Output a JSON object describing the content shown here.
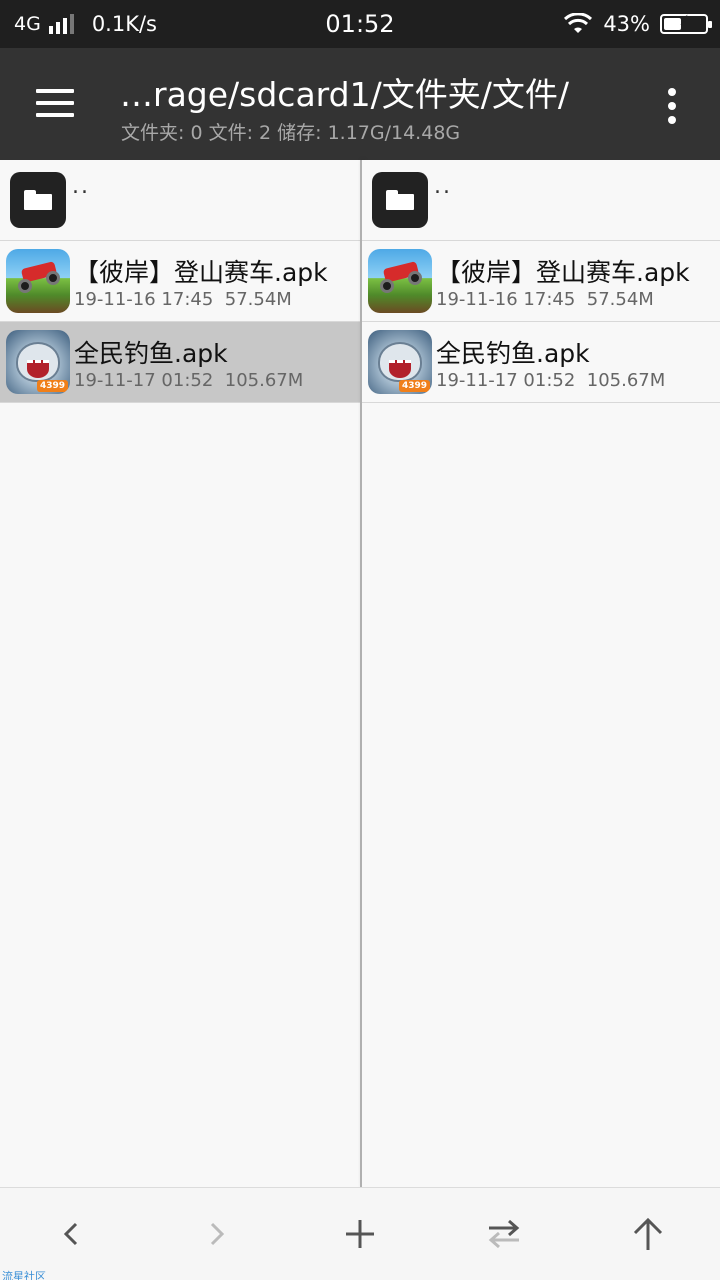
{
  "status_bar": {
    "network": "4G",
    "speed": "0.1K/s",
    "time": "01:52",
    "battery_percent": "43%",
    "battery_level": 0.43,
    "icons": [
      "signal-icon",
      "wifi-icon",
      "battery-charging-icon"
    ]
  },
  "toolbar": {
    "path": "…rage/sdcard1/文件夹/文件/",
    "info": "文件夹: 0  文件: 2  储存: 1.17G/14.48G",
    "icons": [
      "menu-icon",
      "more-vertical-icon"
    ]
  },
  "left_pane": {
    "parent_label": "..",
    "files": [
      {
        "name": "【彼岸】登山赛车.apk",
        "date": "19-11-16 17:45",
        "size": "57.54M",
        "icon": "hill-climb-app-icon",
        "selected": false
      },
      {
        "name": "全民钓鱼.apk",
        "date": "19-11-17 01:52",
        "size": "105.67M",
        "icon": "shark-fishing-app-icon",
        "badge": "4399",
        "selected": true
      }
    ]
  },
  "right_pane": {
    "parent_label": "..",
    "files": [
      {
        "name": "【彼岸】登山赛车.apk",
        "date": "19-11-16 17:45",
        "size": "57.54M",
        "icon": "hill-climb-app-icon",
        "selected": false
      },
      {
        "name": "全民钓鱼.apk",
        "date": "19-11-17 01:52",
        "size": "105.67M",
        "icon": "shark-fishing-app-icon",
        "badge": "4399",
        "selected": false
      }
    ]
  },
  "bottom_bar": {
    "buttons": [
      "back-icon",
      "forward-icon",
      "add-icon",
      "swap-icon",
      "up-icon"
    ],
    "colors": {
      "active": "#555555",
      "disabled": "#bbbbbb"
    }
  },
  "watermark": "流星社区",
  "colors": {
    "toolbar": "#333333",
    "status_bar": "#1f1f1f",
    "selected_row": "#c7c7c7"
  }
}
